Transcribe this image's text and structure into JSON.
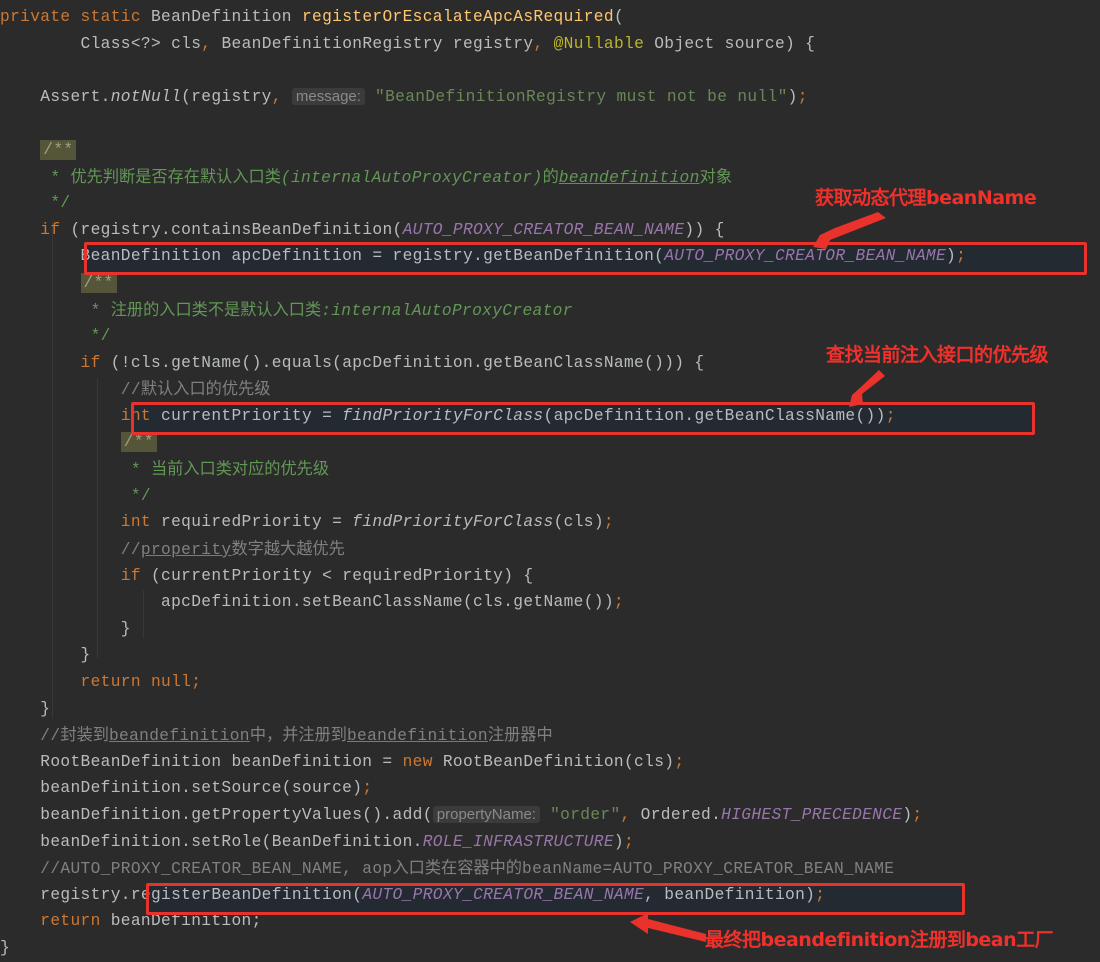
{
  "editor": {
    "theme": "Darcula",
    "colors": {
      "background": "#2b2b2b",
      "keyword": "#cc7832",
      "method_declaration": "#ffc66d",
      "annotation": "#bbb529",
      "string": "#6a8759",
      "constant": "#9876aa",
      "comment": "#808080",
      "doc_comment": "#629755",
      "highlight": "#e8322b"
    },
    "lines": [
      {
        "id": "L1",
        "tokens": [
          {
            "t": "private static ",
            "c": "kw"
          },
          {
            "t": "BeanDefinition "
          },
          {
            "t": "registerOrEscalateApcAsRequired",
            "c": "fn"
          },
          {
            "t": "("
          }
        ]
      },
      {
        "id": "L2",
        "tokens": [
          {
            "t": "        Class<?> cls"
          },
          {
            "t": ", ",
            "c": "kw"
          },
          {
            "t": "BeanDefinitionRegistry registry"
          },
          {
            "t": ", ",
            "c": "kw"
          },
          {
            "t": "@Nullable",
            "c": "ann"
          },
          {
            "t": " Object source) {"
          }
        ]
      },
      {
        "id": "L3",
        "tokens": []
      },
      {
        "id": "L4",
        "tokens": [
          {
            "t": "    Assert."
          },
          {
            "t": "notNull",
            "c": "ital"
          },
          {
            "t": "(registry"
          },
          {
            "t": ", ",
            "c": "kw"
          },
          {
            "t": "message:",
            "c": "hint"
          },
          {
            "t": " "
          },
          {
            "t": "\"BeanDefinitionRegistry must not be null\"",
            "c": "str"
          },
          {
            "t": ")"
          },
          {
            "t": ";",
            "c": "kw"
          }
        ]
      },
      {
        "id": "L5",
        "tokens": []
      },
      {
        "id": "L6",
        "tokens": [
          {
            "t": "    "
          },
          {
            "t": "/**",
            "c": "docbadge"
          }
        ]
      },
      {
        "id": "L7",
        "tokens": [
          {
            "t": "     * ",
            "c": "doc"
          },
          {
            "t": "优先判断是否存在默认入口类",
            "c": "doc cjk"
          },
          {
            "t": "(internalAutoProxyCreator)",
            "c": "doci"
          },
          {
            "t": "的",
            "c": "doc cjk"
          },
          {
            "t": "beandefinition",
            "c": "doci ul"
          },
          {
            "t": "对象",
            "c": "doc cjk"
          }
        ]
      },
      {
        "id": "L8",
        "tokens": [
          {
            "t": "     */",
            "c": "doc"
          }
        ]
      },
      {
        "id": "L9",
        "tokens": [
          {
            "t": "    "
          },
          {
            "t": "if ",
            "c": "kw"
          },
          {
            "t": "(registry.containsBeanDefinition("
          },
          {
            "t": "AUTO_PROXY_CREATOR_BEAN_NAME",
            "c": "cst"
          },
          {
            "t": ")) {"
          }
        ]
      },
      {
        "id": "L10",
        "tokens": [
          {
            "t": "        BeanDefinition apcDefinition = registry.getBeanDefinition("
          },
          {
            "t": "AUTO_PROXY_CREATOR_BEAN_NAME",
            "c": "cst"
          },
          {
            "t": ")"
          },
          {
            "t": ";",
            "c": "kw"
          }
        ]
      },
      {
        "id": "L11",
        "tokens": [
          {
            "t": "        "
          },
          {
            "t": "/**",
            "c": "docbadge"
          }
        ]
      },
      {
        "id": "L12",
        "tokens": [
          {
            "t": "         * ",
            "c": "doc"
          },
          {
            "t": "注册的入口类不是默认入口类",
            "c": "doc cjk"
          },
          {
            "t": ":internalAutoProxyCreator",
            "c": "doci"
          }
        ]
      },
      {
        "id": "L13",
        "tokens": [
          {
            "t": "         */",
            "c": "doc"
          }
        ]
      },
      {
        "id": "L14",
        "tokens": [
          {
            "t": "        "
          },
          {
            "t": "if ",
            "c": "kw"
          },
          {
            "t": "(!cls.getName().equals(apcDefinition.getBeanClassName())) {"
          }
        ]
      },
      {
        "id": "L15",
        "tokens": [
          {
            "t": "            //",
            "c": "cmt"
          },
          {
            "t": "默认入口的优先级",
            "c": "cmt cjk"
          }
        ]
      },
      {
        "id": "L16",
        "tokens": [
          {
            "t": "            "
          },
          {
            "t": "int ",
            "c": "kw"
          },
          {
            "t": "currentPriority = "
          },
          {
            "t": "findPriorityForClass",
            "c": "ital"
          },
          {
            "t": "(apcDefinition.getBeanClassName())"
          },
          {
            "t": ";",
            "c": "kw"
          }
        ]
      },
      {
        "id": "L17",
        "tokens": [
          {
            "t": "            "
          },
          {
            "t": "/**",
            "c": "docbadge"
          }
        ]
      },
      {
        "id": "L18",
        "tokens": [
          {
            "t": "             * ",
            "c": "doc"
          },
          {
            "t": "当前入口类对应的优先级",
            "c": "doc cjk"
          }
        ]
      },
      {
        "id": "L19",
        "tokens": [
          {
            "t": "             */",
            "c": "doc"
          }
        ]
      },
      {
        "id": "L20",
        "tokens": [
          {
            "t": "            "
          },
          {
            "t": "int ",
            "c": "kw"
          },
          {
            "t": "requiredPriority = "
          },
          {
            "t": "findPriorityForClass",
            "c": "ital"
          },
          {
            "t": "(cls)"
          },
          {
            "t": ";",
            "c": "kw"
          }
        ]
      },
      {
        "id": "L21",
        "tokens": [
          {
            "t": "            //",
            "c": "cmt"
          },
          {
            "t": "properity",
            "c": "cmt ul"
          },
          {
            "t": "数字越大越优先",
            "c": "cmt cjk"
          }
        ]
      },
      {
        "id": "L22",
        "tokens": [
          {
            "t": "            "
          },
          {
            "t": "if ",
            "c": "kw"
          },
          {
            "t": "(currentPriority < requiredPriority) {"
          }
        ]
      },
      {
        "id": "L23",
        "tokens": [
          {
            "t": "                apcDefinition.setBeanClassName(cls.getName())"
          },
          {
            "t": ";",
            "c": "kw"
          }
        ]
      },
      {
        "id": "L24",
        "tokens": [
          {
            "t": "            }"
          }
        ]
      },
      {
        "id": "L25",
        "tokens": [
          {
            "t": "        }"
          }
        ]
      },
      {
        "id": "L26",
        "tokens": [
          {
            "t": "        "
          },
          {
            "t": "return null;",
            "c": "kw"
          }
        ]
      },
      {
        "id": "L27",
        "tokens": [
          {
            "t": "    }"
          }
        ]
      },
      {
        "id": "L28",
        "tokens": [
          {
            "t": "    //",
            "c": "cmt"
          },
          {
            "t": "封装到",
            "c": "cmt cjk"
          },
          {
            "t": "beandefinition",
            "c": "cmt ul"
          },
          {
            "t": "中，并注册到",
            "c": "cmt cjk"
          },
          {
            "t": "beandefinition",
            "c": "cmt ul"
          },
          {
            "t": "注册器中",
            "c": "cmt cjk"
          }
        ]
      },
      {
        "id": "L29",
        "tokens": [
          {
            "t": "    RootBeanDefinition beanDefinition = "
          },
          {
            "t": "new ",
            "c": "kw"
          },
          {
            "t": "RootBeanDefinition(cls)"
          },
          {
            "t": ";",
            "c": "kw"
          }
        ]
      },
      {
        "id": "L30",
        "tokens": [
          {
            "t": "    beanDefinition.setSource(source)"
          },
          {
            "t": ";",
            "c": "kw"
          }
        ]
      },
      {
        "id": "L31",
        "tokens": [
          {
            "t": "    beanDefinition.getPropertyValues().add("
          },
          {
            "t": "propertyName:",
            "c": "hint"
          },
          {
            "t": " "
          },
          {
            "t": "\"order\"",
            "c": "str"
          },
          {
            "t": ", ",
            "c": "kw"
          },
          {
            "t": "Ordered."
          },
          {
            "t": "HIGHEST_PRECEDENCE",
            "c": "cst"
          },
          {
            "t": ")"
          },
          {
            "t": ";",
            "c": "kw"
          }
        ]
      },
      {
        "id": "L32",
        "tokens": [
          {
            "t": "    beanDefinition.setRole(BeanDefinition."
          },
          {
            "t": "ROLE_INFRASTRUCTURE",
            "c": "cst"
          },
          {
            "t": ")"
          },
          {
            "t": ";",
            "c": "kw"
          }
        ]
      },
      {
        "id": "L33",
        "tokens": [
          {
            "t": "    //AUTO_PROXY_CREATOR_BEAN_NAME, aop",
            "c": "cmt"
          },
          {
            "t": "入口类在容器中的",
            "c": "cmt cjk"
          },
          {
            "t": "beanName=AUTO_PROXY_CREATOR_BEAN_NAME",
            "c": "cmt"
          }
        ]
      },
      {
        "id": "L34",
        "tokens": [
          {
            "t": "    registry.registerBeanDefinition("
          },
          {
            "t": "AUTO_PROXY_CREATOR_BEAN_NAME",
            "c": "cst"
          },
          {
            "t": ", "
          },
          {
            "t": "beanDefinition)"
          },
          {
            "t": ";",
            "c": "kw"
          }
        ]
      },
      {
        "id": "L35",
        "tokens": [
          {
            "t": "    "
          },
          {
            "t": "return ",
            "c": "kw"
          },
          {
            "t": "beanDefinition;"
          }
        ]
      },
      {
        "id": "L36",
        "tokens": [
          {
            "t": "}"
          }
        ]
      }
    ]
  },
  "annotations": [
    {
      "id": "get-proxy-beanname",
      "text": "获取动态代理beanName",
      "target_line": "L10"
    },
    {
      "id": "find-current-priority",
      "text": "查找当前注入接口的优先级",
      "target_line": "L16"
    },
    {
      "id": "register-to-factory",
      "text": "最终把beandefinition注册到bean工厂",
      "target_line": "L34"
    }
  ]
}
